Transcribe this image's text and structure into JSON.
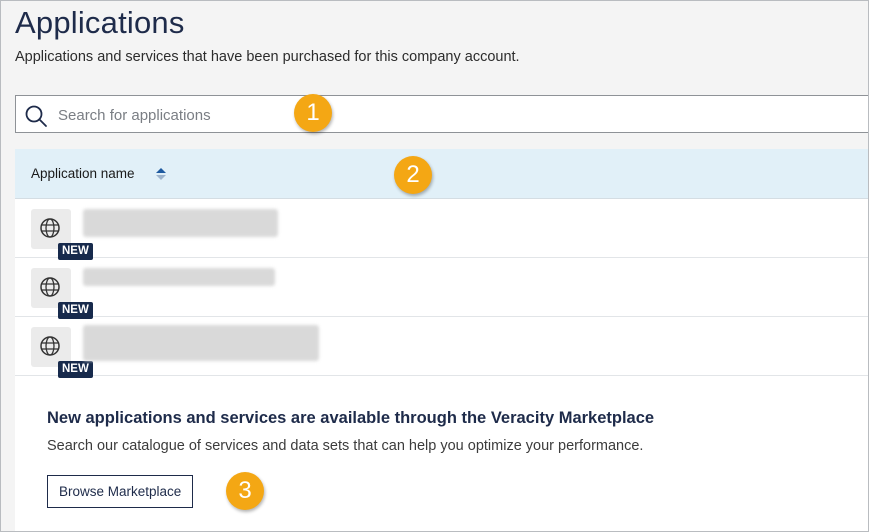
{
  "header": {
    "title": "Applications",
    "subtitle": "Applications and services that have been purchased for this company account."
  },
  "search": {
    "placeholder": "Search for applications",
    "icon": "search-icon"
  },
  "table": {
    "column_header": "Application name",
    "sort_icon": "sort-ascending-icon",
    "rows": [
      {
        "icon": "globe-icon",
        "badge": "NEW"
      },
      {
        "icon": "globe-icon",
        "badge": "NEW"
      },
      {
        "icon": "globe-icon",
        "badge": "NEW"
      }
    ]
  },
  "promo": {
    "heading": "New applications and services are available through the Veracity Marketplace",
    "text": "Search our catalogue of services and data sets that can help you optimize your performance.",
    "button_label": "Browse Marketplace"
  },
  "callouts": [
    "1",
    "2",
    "3"
  ],
  "colors": {
    "callout": "#f4a714",
    "header_band": "#e1f0f8",
    "badge": "#172a4c",
    "brand_text": "#1e2b4a"
  }
}
